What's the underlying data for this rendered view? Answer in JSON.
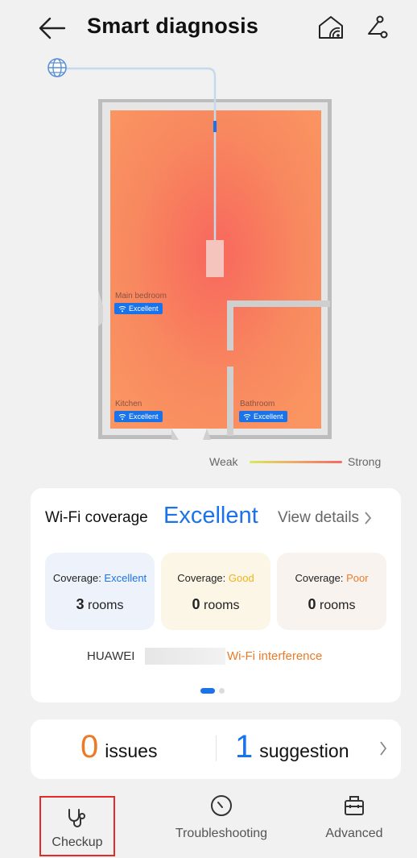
{
  "header": {
    "title": "Smart diagnosis"
  },
  "floorplan": {
    "rooms": [
      {
        "name": "Main bedroom",
        "signal": "Excellent"
      },
      {
        "name": "Kitchen",
        "signal": "Excellent"
      },
      {
        "name": "Bathroom",
        "signal": "Excellent"
      }
    ],
    "legend": {
      "weak": "Weak",
      "strong": "Strong"
    }
  },
  "coverage": {
    "title": "Wi-Fi coverage",
    "status": "Excellent",
    "view_details": "View details",
    "tiles": [
      {
        "label": "Coverage: ",
        "level": "Excellent",
        "count": "3",
        "unit": "rooms"
      },
      {
        "label": "Coverage: ",
        "level": "Good",
        "count": "0",
        "unit": "rooms"
      },
      {
        "label": "Coverage: ",
        "level": "Poor",
        "count": "0",
        "unit": "rooms"
      }
    ],
    "network_name": "HUAWEI",
    "network_issue": "Wi-Fi interference"
  },
  "summary": {
    "issues_count": "0",
    "issues_label": "issues",
    "suggestions_count": "1",
    "suggestions_label": "suggestion"
  },
  "nav": {
    "items": [
      {
        "label": "Checkup"
      },
      {
        "label": "Troubleshooting"
      },
      {
        "label": "Advanced"
      }
    ]
  },
  "colors": {
    "accent": "#1a73e8",
    "good": "#f2b21b",
    "poor": "#ec7a27",
    "highlight_border": "#e52a2a"
  }
}
